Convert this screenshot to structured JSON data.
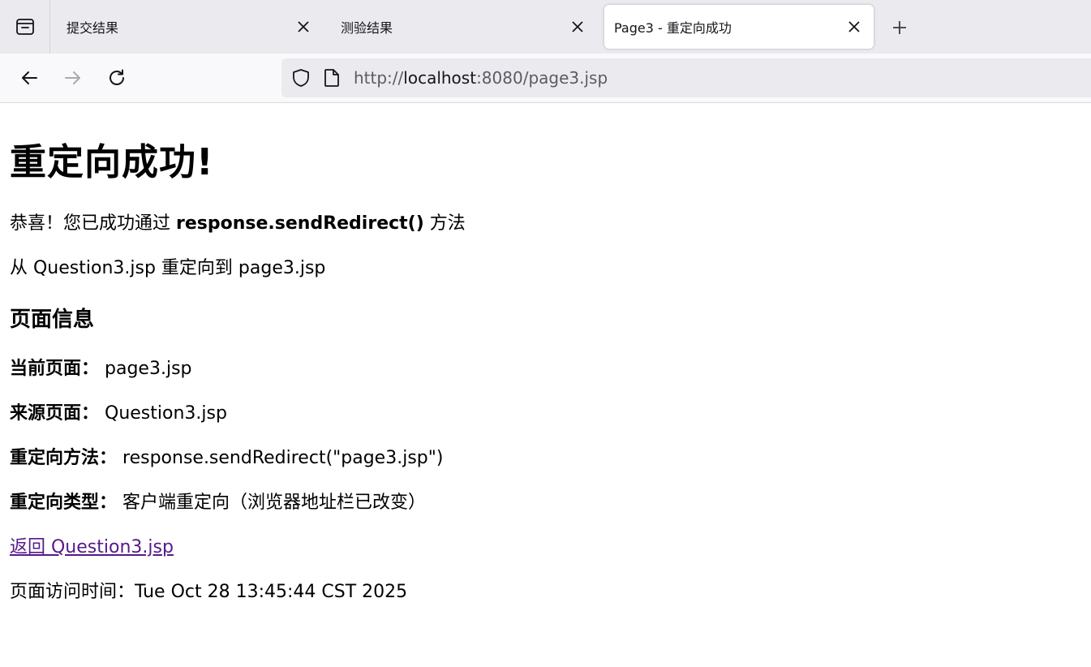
{
  "tabs": [
    {
      "title": "提交结果",
      "active": false
    },
    {
      "title": "测验结果",
      "active": false
    },
    {
      "title": "Page3 - 重定向成功",
      "active": true
    }
  ],
  "icons": {
    "tab_list": "tab-list-icon",
    "close": "close-icon",
    "new_tab": "plus-icon",
    "back": "arrow-left-icon",
    "forward": "arrow-right-icon",
    "reload": "reload-icon",
    "shield": "shield-icon",
    "page": "page-icon"
  },
  "urlbar": {
    "scheme": "http://",
    "host": "localhost",
    "rest": ":8080/page3.jsp"
  },
  "page": {
    "heading": "重定向成功!",
    "congrats_prefix": "恭喜！您已成功通过 ",
    "congrats_method": "response.sendRedirect()",
    "congrats_suffix": " 方法",
    "redirect_line": "从 Question3.jsp 重定向到 page3.jsp",
    "info_heading": "页面信息",
    "info": [
      {
        "label": "当前页面：",
        "value": "page3.jsp"
      },
      {
        "label": "来源页面：",
        "value": "Question3.jsp"
      },
      {
        "label": "重定向方法：",
        "value": "response.sendRedirect(\"page3.jsp\")"
      },
      {
        "label": "重定向类型：",
        "value": "客户端重定向（浏览器地址栏已改变）"
      }
    ],
    "back_link": "返回 Question3.jsp",
    "visit_time_label": "页面访问时间：",
    "visit_time": "Tue Oct 28 13:45:44 CST 2025"
  },
  "colors": {
    "link_visited": "#551a8b",
    "tabbar_bg": "#ebebef",
    "urlbar_bg": "#ebebef",
    "url_text": "#5b5b66"
  }
}
